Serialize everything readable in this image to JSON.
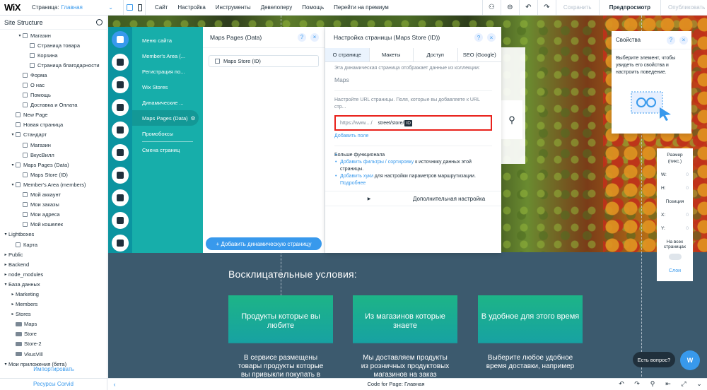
{
  "topbar": {
    "logo": "WiX",
    "page_label": "Страница:",
    "page_current": "Главная",
    "menu": [
      "Сайт",
      "Настройка",
      "Инструменты",
      "Девелоперу",
      "Помощь",
      "Перейти на премиум"
    ],
    "save": "Сохранить",
    "preview": "Предпросмотр",
    "publish": "Опубликовать"
  },
  "site_structure": {
    "title": "Site Structure",
    "items": [
      {
        "label": "Магазин",
        "level": 2,
        "type": "page",
        "arrow": "▾"
      },
      {
        "label": "Страница товара",
        "level": 3,
        "type": "page",
        "arrow": ""
      },
      {
        "label": "Корзина",
        "level": 3,
        "type": "page",
        "arrow": ""
      },
      {
        "label": "Страница благодарности",
        "level": 3,
        "type": "page",
        "arrow": ""
      },
      {
        "label": "Форма",
        "level": 2,
        "type": "page",
        "arrow": ""
      },
      {
        "label": "О нас",
        "level": 2,
        "type": "page",
        "arrow": ""
      },
      {
        "label": "Помощь",
        "level": 2,
        "type": "page",
        "arrow": ""
      },
      {
        "label": "Доставка и Оплата",
        "level": 2,
        "type": "page",
        "arrow": ""
      },
      {
        "label": "New Page",
        "level": 1,
        "type": "page",
        "arrow": ""
      },
      {
        "label": "Новая страница",
        "level": 1,
        "type": "page",
        "arrow": ""
      },
      {
        "label": "Стандарт",
        "level": 1,
        "type": "page",
        "arrow": "▾"
      },
      {
        "label": "Магазин",
        "level": 2,
        "type": "page",
        "arrow": ""
      },
      {
        "label": "ВкусВилл",
        "level": 2,
        "type": "page",
        "arrow": ""
      },
      {
        "label": "Maps Pages (Data)",
        "level": 1,
        "type": "page",
        "arrow": "▾"
      },
      {
        "label": "Maps Store (ID)",
        "level": 2,
        "type": "page",
        "arrow": ""
      },
      {
        "label": "Member's Area (members)",
        "level": 1,
        "type": "page",
        "arrow": "▾"
      },
      {
        "label": "Мой аккаунт",
        "level": 2,
        "type": "page",
        "arrow": ""
      },
      {
        "label": "Мои заказы",
        "level": 2,
        "type": "page",
        "arrow": ""
      },
      {
        "label": "Мои адреса",
        "level": 2,
        "type": "page",
        "arrow": ""
      },
      {
        "label": "Мой кошелек",
        "level": 2,
        "type": "page",
        "arrow": ""
      },
      {
        "label": "Lightboxes",
        "level": 0,
        "type": "none",
        "arrow": "▾"
      },
      {
        "label": "Карта",
        "level": 1,
        "type": "page",
        "arrow": ""
      },
      {
        "label": "Public",
        "level": 0,
        "type": "none",
        "arrow": "▸"
      },
      {
        "label": "Backend",
        "level": 0,
        "type": "none",
        "arrow": "▸"
      },
      {
        "label": "node_modules",
        "level": 0,
        "type": "none",
        "arrow": "▸"
      },
      {
        "label": "База данных",
        "level": 0,
        "type": "none",
        "arrow": "▾"
      },
      {
        "label": "Marketing",
        "level": 1,
        "type": "none",
        "arrow": "▸"
      },
      {
        "label": "Members",
        "level": 1,
        "type": "none",
        "arrow": "▸"
      },
      {
        "label": "Stores",
        "level": 1,
        "type": "none",
        "arrow": "▸"
      },
      {
        "label": "Maps",
        "level": 1,
        "type": "folder",
        "arrow": ""
      },
      {
        "label": "Store",
        "level": 1,
        "type": "folder",
        "arrow": ""
      },
      {
        "label": "Store-2",
        "level": 1,
        "type": "folder",
        "arrow": ""
      },
      {
        "label": "VkusVill",
        "level": 1,
        "type": "folder",
        "arrow": ""
      },
      {
        "label": "Мои приложения (бета)",
        "level": 0,
        "type": "none",
        "arrow": "▾"
      }
    ],
    "import_link": "Импортировать"
  },
  "dynamic_menu": {
    "items": [
      "Меню сайта",
      "Member's Area (...",
      "Регистрация по...",
      "Wix Stores",
      "Динамические ...",
      "Maps Pages (Data)",
      "Промобоксы",
      "Смена страниц"
    ],
    "selected_index": 5
  },
  "maps_panel": {
    "title": "Maps Pages (Data)",
    "store_item": "Maps Store (ID)",
    "add_button": "+ Добавить динамическую страницу"
  },
  "settings_panel": {
    "title": "Настройка страницы (Maps Store (ID))",
    "tabs": [
      "О странице",
      "Макеты",
      "Доступ",
      "SEO (Google)"
    ],
    "active_tab": 0,
    "collection_text": "Эта динамическая страница отображает данные из коллекции:",
    "collection_value": "Maps",
    "url_text": "Настройте URL страницы. Поля, которые вы добавляете к URL стр...",
    "url_base": "https://www..../",
    "url_segment": "street/store/",
    "url_id": "ID",
    "add_field": "Добавить поле",
    "more_title": "Больше функционала",
    "bullet1_link": "Добавить фильтры / сортировку",
    "bullet1_text": " к источнику данных этой страницы.",
    "bullet2_link": "Добавить хуки",
    "bullet2_text": " для настройки параметров маршрутизации.",
    "bullet2_more": "Подробнее",
    "advanced": "Дополнительная настройка"
  },
  "properties_panel": {
    "title": "Свойства",
    "description": "Выберите элемент, чтобы увидеть его свойства и настроить поведение."
  },
  "size_panel": {
    "size_label": "Размер",
    "size_unit": "(пикс.)",
    "w_label": "W:",
    "w_value": "0",
    "h_label": "H:",
    "h_value": "0",
    "pos_label": "Позиция",
    "x_label": "X:",
    "x_value": "0",
    "y_label": "Y:",
    "y_value": "0",
    "all_pages": "На всех страницах",
    "layers": "Слои"
  },
  "canvas": {
    "section_title": "Восклицательные условия:",
    "cards": [
      {
        "title": "Продукты которые вы любите",
        "desc": "В сервисе размещены товары продукты которые вы привыкли покупать в"
      },
      {
        "title": "Из магазинов которые знаете",
        "desc": "Мы доставляем продукты из розничных продуктовых магазинов на заказ"
      },
      {
        "title": "В удобное для этого время",
        "desc": "Выберите любое удобное время доставки, например"
      }
    ]
  },
  "chat": {
    "label": "Есть вопрос?",
    "avatar": "W"
  },
  "bottom": {
    "resources": "Ресурсы Corvid",
    "code_label": "Code for Page: Главная"
  }
}
